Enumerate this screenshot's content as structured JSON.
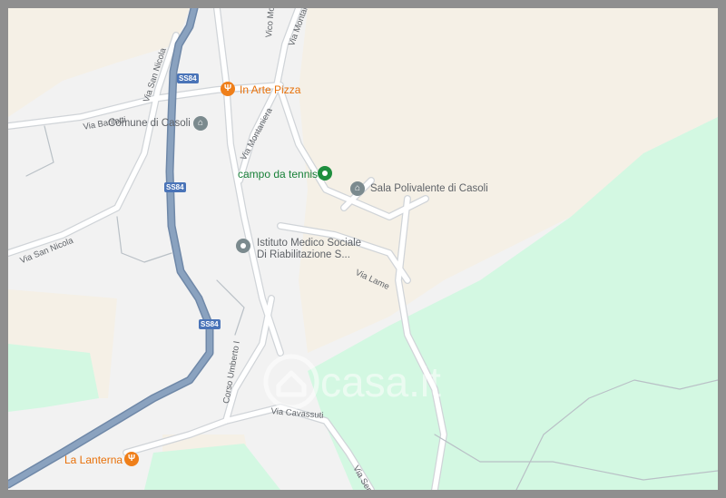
{
  "map": {
    "provider_watermark": "casa.it",
    "colors": {
      "land": "#f2f2f2",
      "urban_beige": "#f5f0e6",
      "park_green": "#d3f8e2",
      "road_white": "#ffffff",
      "road_outline": "#c8ccd0",
      "highway": "#8aa2bf",
      "poi_orange": "#e8710a",
      "poi_green": "#188038",
      "poi_gray": "#5f6368"
    },
    "highway_shields": [
      {
        "label": "SS84"
      },
      {
        "label": "SS84"
      },
      {
        "label": "SS84"
      }
    ],
    "street_labels": [
      {
        "name": "Via Montaniera"
      },
      {
        "name": "Vico Mo"
      },
      {
        "name": "Via San Nicola"
      },
      {
        "name": "Via Barilotti"
      },
      {
        "name": "Via Montaniera"
      },
      {
        "name": "Via San Nicola"
      },
      {
        "name": "Via Lame"
      },
      {
        "name": "Corso Umberto I"
      },
      {
        "name": "Via Cavassuti"
      },
      {
        "name": "Via Serre"
      }
    ],
    "places": [
      {
        "name": "In Arte Pizza",
        "category": "restaurant",
        "icon": "fork-knife-icon"
      },
      {
        "name": "Comune di Casoli",
        "category": "government",
        "icon": "building-icon"
      },
      {
        "name": "campo da tennis",
        "category": "sports",
        "icon": "pin-dot-icon"
      },
      {
        "name": "Sala Polivalente di Casoli",
        "category": "hall",
        "icon": "building-icon"
      },
      {
        "name": "Istituto Medico Sociale",
        "line2": "Di Riabilitazione S...",
        "category": "medical",
        "icon": "pin-dot-icon"
      },
      {
        "name": "La Lanterna",
        "category": "restaurant",
        "icon": "fork-knife-icon"
      }
    ]
  }
}
